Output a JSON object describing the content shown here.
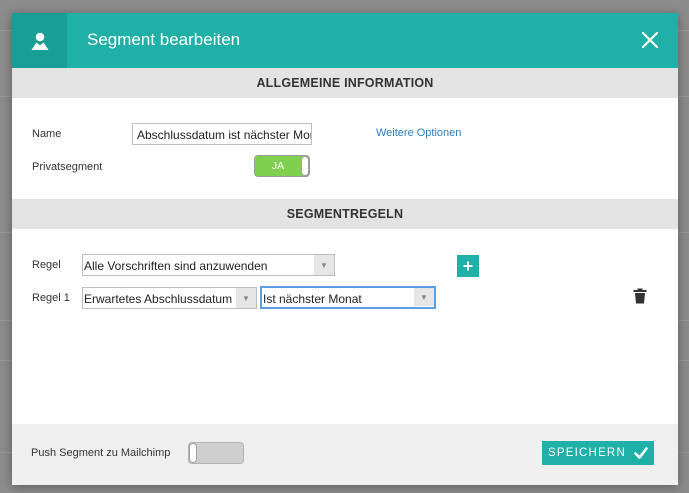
{
  "header": {
    "title": "Segment bearbeiten",
    "icon": "user-icon",
    "close_icon": "close-icon",
    "color": "#1fb0a7"
  },
  "general": {
    "section_title": "ALLGEMEINE INFORMATION",
    "name_label": "Name",
    "name_value": "Abschlussdatum ist nächster Monat",
    "more_options_link": "Weitere Optionen",
    "private_label": "Privatsegment",
    "private_toggle_label": "JA",
    "private_toggle_on": true
  },
  "rules": {
    "section_title": "SEGMENTREGELN",
    "rule_label": "Regel",
    "rule_select_value": "Alle Vorschriften sind anzuwenden",
    "rule1_label": "Regel 1",
    "rule1_field_value": "Erwartetes Abschlussdatum",
    "rule1_condition_value": "Ist nächster Monat",
    "add_icon": "plus-icon",
    "delete_icon": "trash-icon"
  },
  "footer": {
    "push_label": "Push Segment zu Mailchimp",
    "push_toggle_on": false,
    "save_label": "SPEICHERN",
    "save_icon": "check-icon"
  }
}
